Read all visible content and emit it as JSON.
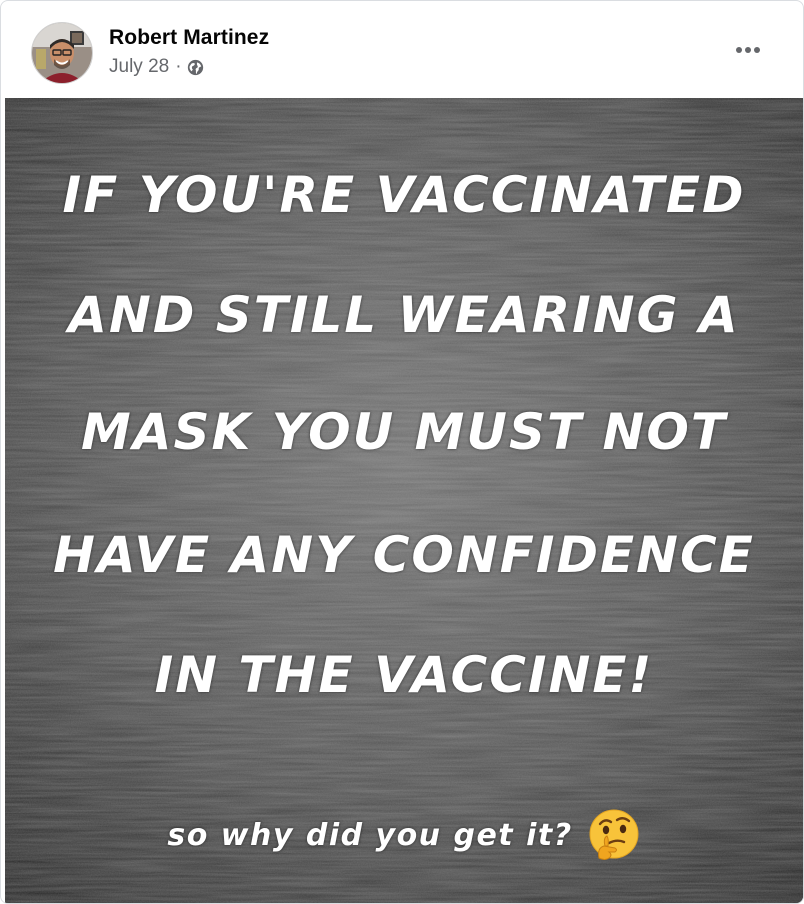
{
  "post": {
    "author_name": "Robert Martinez",
    "date": "July 28",
    "separator": "·",
    "audience_icon": "globe-icon",
    "more_icon": "more-options-icon"
  },
  "image": {
    "lines": [
      "If you're vaccinated",
      "and still wearing a",
      "mask you must not",
      "have any confidence",
      "in the vaccine!"
    ],
    "subline": "so why did you get it?",
    "emoji": "thinking-face-emoji"
  },
  "colors": {
    "name": "#050505",
    "meta": "#65676b",
    "meme_text": "#ffffff",
    "meme_bg": "#3a3a3a"
  }
}
